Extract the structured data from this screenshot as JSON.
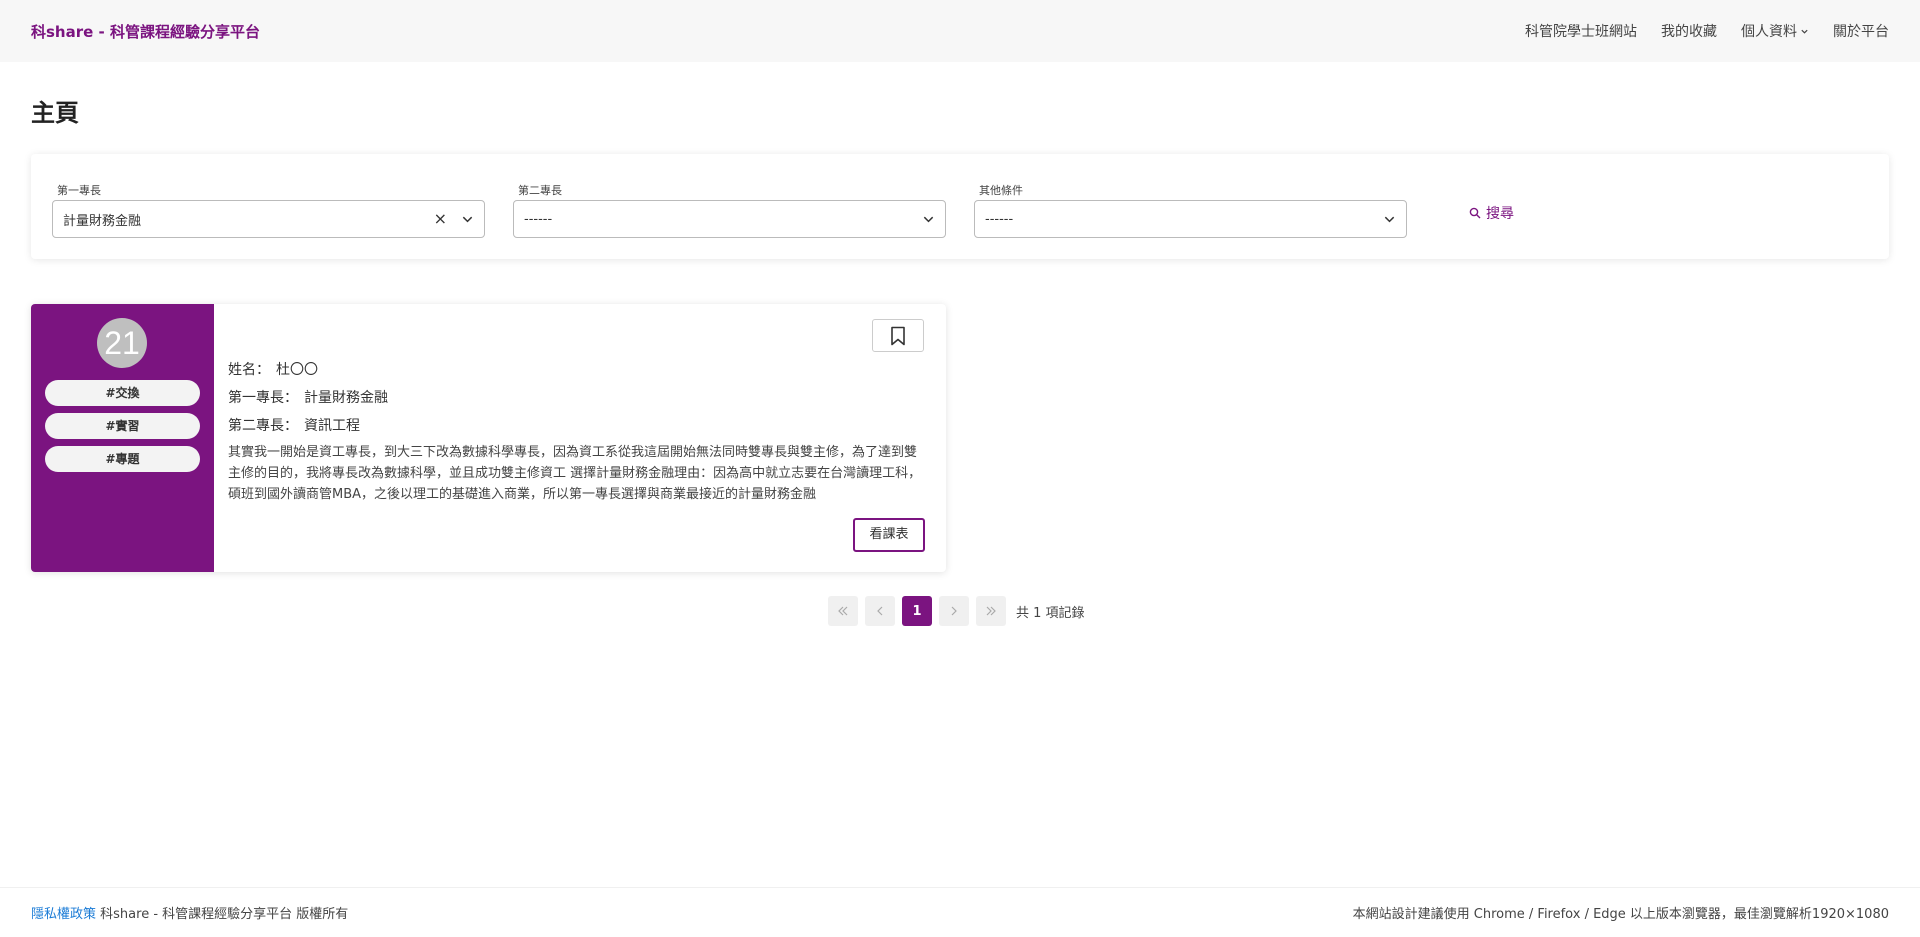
{
  "navbar": {
    "brand": "科share - 科管課程經驗分享平台",
    "items": [
      {
        "label": "科管院學士班網站"
      },
      {
        "label": "我的收藏"
      },
      {
        "label": "個人資料"
      },
      {
        "label": "關於平台"
      }
    ]
  },
  "page": {
    "title": "主頁"
  },
  "filters": {
    "first_major": {
      "label": "第一專長",
      "value": "計量財務金融"
    },
    "second_major": {
      "label": "第二專長",
      "value": "------"
    },
    "other": {
      "label": "其他條件",
      "value": "------"
    },
    "search_label": "搜尋"
  },
  "card": {
    "avatar_text": "21",
    "tags": [
      "#交換",
      "#實習",
      "#專題"
    ],
    "name_label": "姓名：",
    "name": "杜〇〇",
    "first_major_label": "第一專長：",
    "first_major": "計量財務金融",
    "second_major_label": "第二專長：",
    "second_major": "資訊工程",
    "description": "其實我一開始是資工專長，到大三下改為數據科學專長，因為資工系從我這屆開始無法同時雙專長與雙主修，為了達到雙主修的目的，我將專長改為數據科學，並且成功雙主修資工 選擇計量財務金融理由：因為高中就立志要在台灣讀理工科，碩班到國外讀商管MBA，之後以理工的基礎進入商業，所以第一專長選擇與商業最接近的計量財務金融",
    "course_button": "看課表"
  },
  "pagination": {
    "current_page": "1",
    "total_text": "共 1 項記錄"
  },
  "footer": {
    "privacy": "隱私權政策",
    "copyright": "科share - 科管課程經驗分享平台 版權所有",
    "browser_note": "本網站設計建議使用 Chrome / Firefox / Edge 以上版本瀏覽器，最佳瀏覽解析1920×1080"
  },
  "colors": {
    "brand": "#7b1480",
    "link": "#1a7bd6"
  }
}
